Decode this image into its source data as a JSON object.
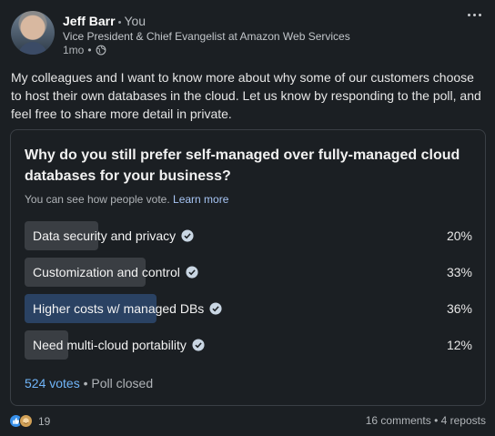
{
  "author": {
    "name": "Jeff Barr",
    "relation": "You",
    "title": "Vice President & Chief Evangelist at Amazon Web Services",
    "posted": "1mo",
    "visibility_icon": "globe-icon"
  },
  "post": {
    "text": "My colleagues and I want to know more about why some of our customers choose to host their own databases in the cloud. Let us know by responding to the poll, and feel free to share more detail in private."
  },
  "poll": {
    "question": "Why do you still prefer self-managed over fully-managed cloud databases for your business?",
    "note": "You can see how people vote.",
    "learn_more": "Learn more",
    "options": [
      {
        "label": "Data security and privacy",
        "percent_text": "20%",
        "percent": 20
      },
      {
        "label": "Customization and control",
        "percent_text": "33%",
        "percent": 33
      },
      {
        "label": "Higher costs w/ managed DBs",
        "percent_text": "36%",
        "percent": 36
      },
      {
        "label": "Need multi-cloud portability",
        "percent_text": "12%",
        "percent": 12
      }
    ],
    "votes": "524 votes",
    "status": "Poll closed"
  },
  "social": {
    "reaction_count": "19",
    "stats": "16 comments • 4 reposts"
  },
  "colors": {
    "background": "#1b1f23",
    "bar": "#3a3e43",
    "bar_top": "#2a4263",
    "link": "#70b5f9"
  }
}
